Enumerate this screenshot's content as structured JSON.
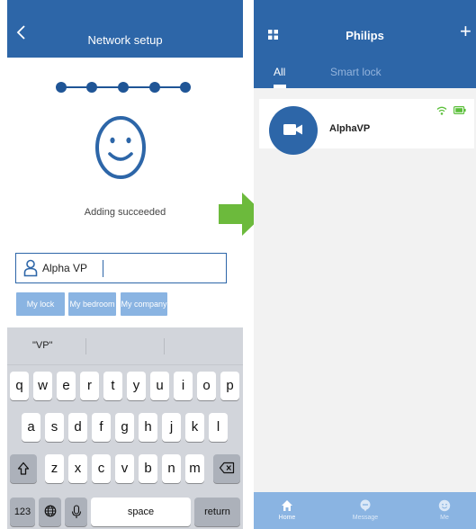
{
  "left_screen": {
    "header": {
      "title": "Network setup",
      "back_icon": "chevron-left-icon"
    },
    "progress": {
      "steps_total": 5,
      "steps_done": 5
    },
    "status_icon": "smiley-icon",
    "status_text": "Adding succeeded",
    "name_input": {
      "value": "Alpha VP",
      "icon": "user-icon"
    },
    "name_suggestions": [
      "My lock",
      "My bedroom",
      "My company"
    ],
    "keyboard": {
      "suggestion": "\"VP\"",
      "row1": [
        "q",
        "w",
        "e",
        "r",
        "t",
        "y",
        "u",
        "i",
        "o",
        "p"
      ],
      "row2": [
        "a",
        "s",
        "d",
        "f",
        "g",
        "h",
        "j",
        "k",
        "l"
      ],
      "row3": [
        "z",
        "x",
        "c",
        "v",
        "b",
        "n",
        "m"
      ],
      "numbers_key": "123",
      "space_key": "space",
      "return_key": "return",
      "icons": {
        "shift": "shift-icon",
        "delete": "backspace-icon",
        "globe": "globe-icon",
        "mic": "microphone-icon"
      }
    }
  },
  "arrow_color": "#6cba3c",
  "right_screen": {
    "header": {
      "title": "Philips",
      "menu_icon": "grid-icon",
      "add_icon": "plus-icon"
    },
    "tabs": [
      {
        "label": "All",
        "active": true
      },
      {
        "label": "Smart lock",
        "active": false
      }
    ],
    "device": {
      "name": "AlphaVP",
      "icon": "video-camera-icon",
      "wifi_color": "#5bbf3a",
      "battery_color": "#5bbf3a"
    },
    "bottom_nav": [
      {
        "label": "Home",
        "icon": "home-icon",
        "active": true
      },
      {
        "label": "Message",
        "icon": "message-icon",
        "active": false
      },
      {
        "label": "Me",
        "icon": "profile-icon",
        "active": false
      }
    ]
  },
  "colors": {
    "primary": "#2d66a8",
    "chip": "#8ab4e2",
    "keyboard_bg": "#d2d5db"
  }
}
